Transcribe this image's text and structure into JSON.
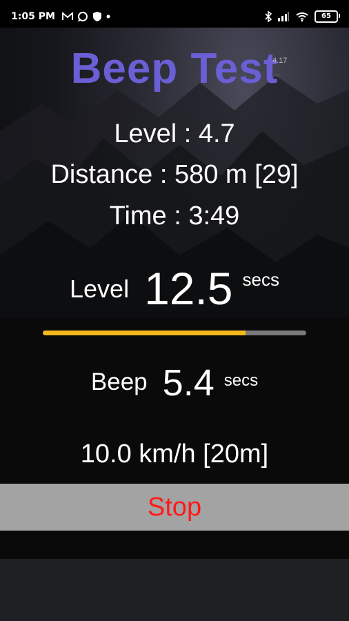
{
  "status_bar": {
    "time": "1:05 PM",
    "battery": "65",
    "icons": [
      "gmail-icon",
      "whatsapp-icon",
      "shield-icon",
      "dot-icon",
      "bluetooth-icon",
      "signal-icon",
      "wifi-icon",
      "battery-icon"
    ]
  },
  "app": {
    "title": "Beep Test",
    "version": "4.17",
    "version_sub": "·.·"
  },
  "stats": {
    "level": "Level : 4.7",
    "distance": "Distance : 580 m [29]",
    "time": "Time : 3:49"
  },
  "level_timer": {
    "label": "Level",
    "value": "12.5",
    "unit": "secs"
  },
  "progress": {
    "fraction": 0.77,
    "fill_color": "#f4b81c",
    "track_color": "#7a7a7a"
  },
  "beep_timer": {
    "label": "Beep",
    "value": "5.4",
    "unit": "secs"
  },
  "speed": "10.0 km/h [20m]",
  "stop_button": {
    "label": "Stop",
    "color": "#ff1a1a"
  },
  "colors": {
    "title": "#6a5fd4",
    "button_bg": "#a3a3a3"
  }
}
